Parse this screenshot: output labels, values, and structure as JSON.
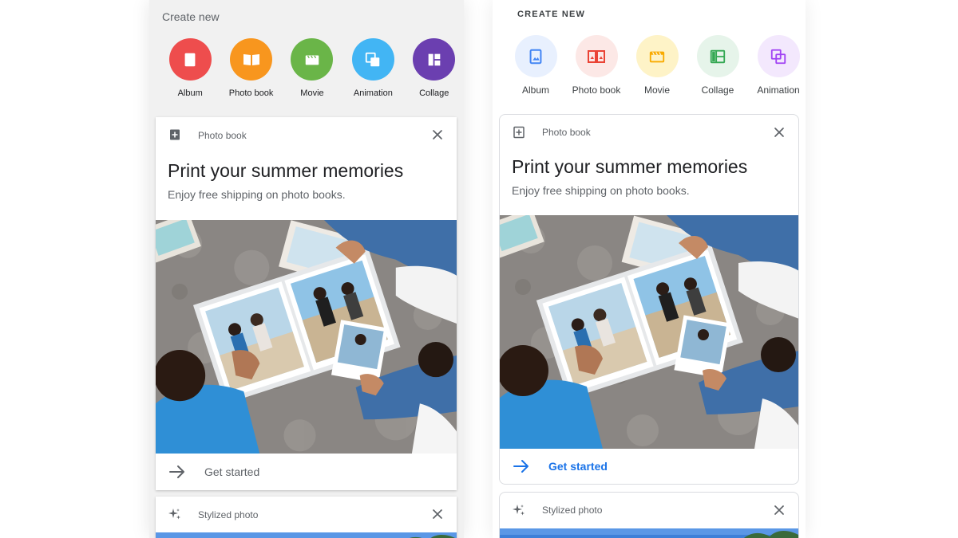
{
  "left_panel": {
    "section_title": "Create new",
    "create_items": [
      {
        "label": "Album",
        "icon": "album-icon",
        "color": "#ee4d4d"
      },
      {
        "label": "Photo book",
        "icon": "photo-book-icon",
        "color": "#f8961e"
      },
      {
        "label": "Movie",
        "icon": "movie-icon",
        "color": "#6ab548"
      },
      {
        "label": "Animation",
        "icon": "animation-icon",
        "color": "#42b5f4"
      },
      {
        "label": "Collage",
        "icon": "collage-icon",
        "color": "#6b3fb0"
      }
    ],
    "card": {
      "type_label": "Photo book",
      "title": "Print your summer memories",
      "subtitle": "Enjoy free shipping on photo books.",
      "action_label": "Get started",
      "action_color": "#5f6368"
    },
    "second_card": {
      "type_label": "Stylized photo"
    }
  },
  "right_panel": {
    "section_title": "CREATE NEW",
    "create_items": [
      {
        "label": "Album",
        "icon": "album-icon",
        "color": "#4285f4",
        "bg": "#e8f0fe"
      },
      {
        "label": "Photo book",
        "icon": "photo-book-icon",
        "color": "#ea4335",
        "bg": "#fce8e6"
      },
      {
        "label": "Movie",
        "icon": "movie-icon",
        "color": "#f9ab00",
        "bg": "#fef3c7"
      },
      {
        "label": "Collage",
        "icon": "collage-icon",
        "color": "#34a853",
        "bg": "#e6f4ea"
      },
      {
        "label": "Animation",
        "icon": "animation-icon",
        "color": "#a142f4",
        "bg": "#f3e8fd"
      }
    ],
    "card": {
      "type_label": "Photo book",
      "title": "Print your summer memories",
      "subtitle": "Enjoy free shipping on photo books.",
      "action_label": "Get started",
      "action_color": "#1a73e8"
    },
    "second_card": {
      "type_label": "Stylized photo"
    }
  }
}
